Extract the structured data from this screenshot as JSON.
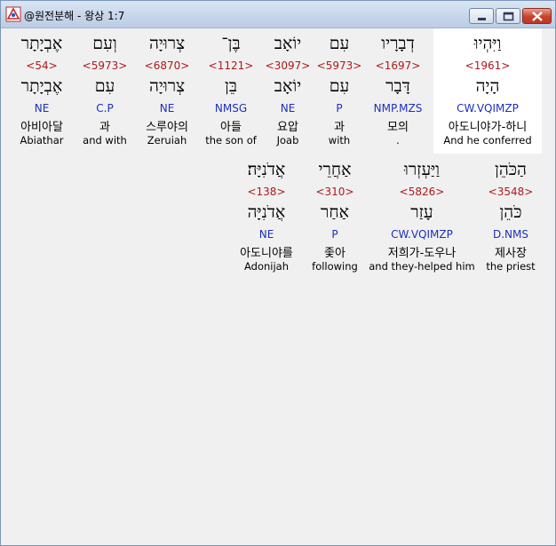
{
  "window": {
    "title": "@원전분해 - 왕상 1:7"
  },
  "rows": [
    [
      {
        "text": "וַיִּהְיוּ",
        "strong": "<1961>",
        "lemma": "הָיָה",
        "code": "CW.VQIMZP",
        "kor": "아도니야가-하니",
        "eng": "And he conferred"
      },
      {
        "text": "דְבָרָיו",
        "strong": "<1697>",
        "lemma": "דָּבָר",
        "code": "NMP.MZS",
        "kor": "모의",
        "eng": "."
      },
      {
        "text": "עִם",
        "strong": "<5973>",
        "lemma": "עִם",
        "code": "P",
        "kor": "과",
        "eng": "with"
      },
      {
        "text": "יוֹאָב",
        "strong": "<3097>",
        "lemma": "יוֹאָב",
        "code": "NE",
        "kor": "요압",
        "eng": "Joab"
      },
      {
        "text": "בֶּן־",
        "strong": "<1121>",
        "lemma": "בֵּן",
        "code": "NMSG",
        "kor": "아들",
        "eng": "the son of"
      },
      {
        "text": "צְרוּיָה",
        "strong": "<6870>",
        "lemma": "צְרוּיָה",
        "code": "NE",
        "kor": "스루야의",
        "eng": "Zeruiah"
      },
      {
        "text": "וְעִם",
        "strong": "<5973>",
        "lemma": "עִם",
        "code": "C.P",
        "kor": "과",
        "eng": "and with"
      },
      {
        "text": "אֶבְיָתָר",
        "strong": "<54>",
        "lemma": "אֶבְיָתָר",
        "code": "NE",
        "kor": "아비아달",
        "eng": "Abiathar"
      }
    ],
    [
      {
        "text": "הַכֹּהֵן",
        "strong": "<3548>",
        "lemma": "כֹּהֵן",
        "code": "D.NMS",
        "kor": "제사장",
        "eng": "the priest"
      },
      {
        "text": "וַיַּעְזְרוּ",
        "strong": "<5826>",
        "lemma": "עָזַר",
        "code": "CW.VQIMZP",
        "kor": "저희가-도우나",
        "eng": "and they-helped him"
      },
      {
        "text": "אַחֲרֵי",
        "strong": "<310>",
        "lemma": "אַחַר",
        "code": "P",
        "kor": "좇아",
        "eng": "following"
      },
      {
        "text": "אֲדֹנִיָּה׃",
        "strong": "<138>",
        "lemma": "אֲדֹנִיָּה",
        "code": "NE",
        "kor": "아도니야를",
        "eng": "Adonijah"
      }
    ]
  ]
}
